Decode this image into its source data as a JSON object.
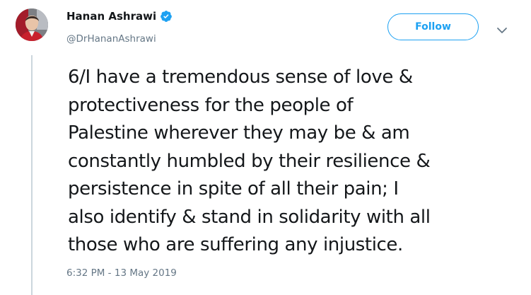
{
  "author": {
    "display_name": "Hanan Ashrawi",
    "handle": "@DrHananAshrawi",
    "verified": true,
    "avatar_icon": "profile-photo"
  },
  "actions": {
    "follow_label": "Follow",
    "menu_icon": "chevron-down-icon"
  },
  "tweet": {
    "lines": [
      "6/I have a tremendous sense of love &",
      "protectiveness for the people of",
      "Palestine wherever they may be & am",
      "constantly humbled by their resilience &",
      "persistence in spite of all their pain; I",
      "also identify & stand in solidarity with all",
      "those who are suffering any injustice."
    ],
    "timestamp": "6:32 PM - 13 May 2019"
  },
  "colors": {
    "accent": "#1da1f2",
    "secondary_text": "#657786",
    "thread_line": "#ccd6dd"
  }
}
